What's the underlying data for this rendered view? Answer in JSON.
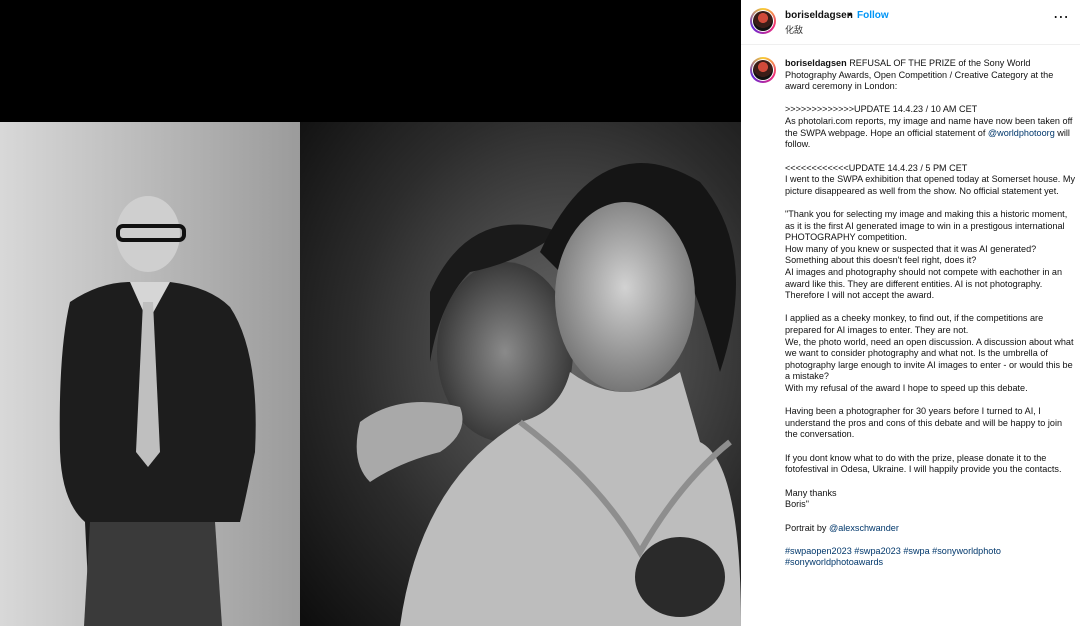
{
  "post": {
    "username": "boriseldagsen",
    "separator": "•",
    "follow_label": "Follow",
    "location": "化敌",
    "more_icon": "more-horizontal-icon"
  },
  "caption": {
    "username": "boriseldagsen",
    "intro": "REFUSAL OF THE PRIZE of the Sony World Photography Awards, Open Competition / Creative Category at the award ceremony in London:",
    "update1_title": ">>>>>>>>>>>>>UPDATE 14.4.23 / 10 AM CET",
    "update1_body": "As photolari.com reports, my image and name have now been taken off the SWPA webpage. Hope an official statement of",
    "update1_mention": "@worldphotoorg",
    "update1_end": "will follow.",
    "update2_title": "<<<<<<<<<<<<UPDATE 14.4.23 / 5 PM CET",
    "update2_body": "I went to the SWPA exhibition that opened today at Somerset house. My picture disappeared as well from the show. No official statement yet.",
    "para1": "\"Thank you for selecting my image and making this a historic moment, as it is the first AI generated image to win in a prestigous international PHOTOGRAPHY competition.",
    "para1b": "How many of you knew or suspected that it was AI generated? Something about this doesn't feel right, does it?",
    "para1c": "AI images and photography should not compete with eachother in an award like this. They are different entities. AI is not photography. Therefore I will not accept the award.",
    "para2": "I applied as a cheeky monkey, to find out, if the competitions are prepared for AI images to enter. They are not.",
    "para2b": "We, the photo world, need an open discussion. A discussion about what we want to consider photography and what not. Is the umbrella of photography large enough to invite AI images to enter - or would this be a mistake?",
    "para2c": "With my refusal of the award I hope to speed up this debate.",
    "para3": "Having been a photographer for 30 years before I turned to AI, I understand the pros and cons of this debate and will be happy to join the conversation.",
    "para4": "If you dont know what to do with the prize, please donate it to the fotofestival in Odesa, Ukraine. I will happily provide you the contacts.",
    "thanks": "Many thanks",
    "signature": "Boris\"",
    "portrait_label": "Portrait by",
    "portrait_mention": "@alexschwander",
    "hashtags": [
      "#swpaopen2023",
      "#swpa2023",
      "#swpa",
      "#sonyworldphoto",
      "#sonyworldphotoawards"
    ]
  }
}
